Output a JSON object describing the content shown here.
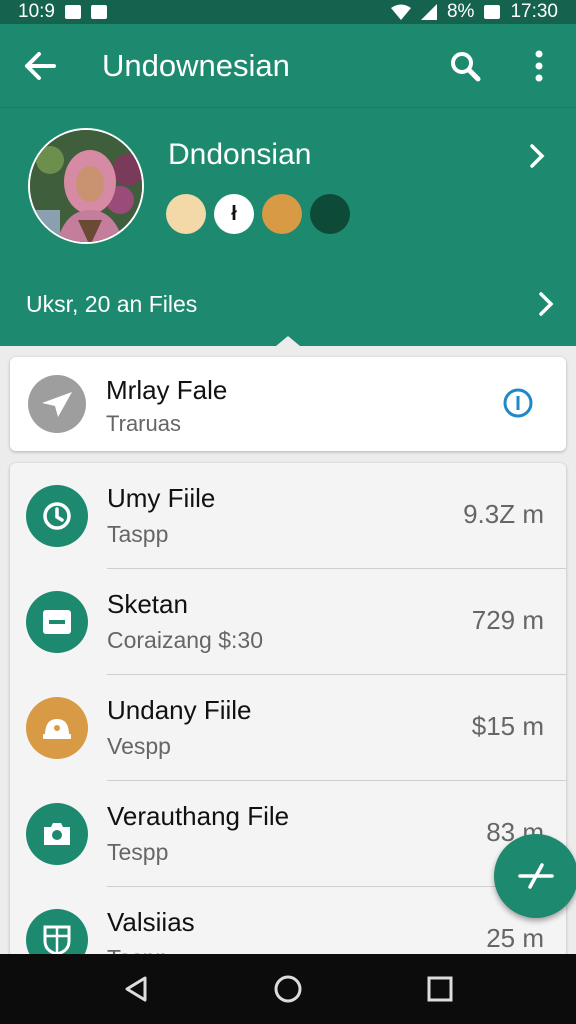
{
  "status_bar": {
    "time_left": "10:9",
    "battery": "8%",
    "time_right": "17:30"
  },
  "app_bar": {
    "title": "Undownesian",
    "back_icon": "arrow-back-icon",
    "search_icon": "search-icon",
    "menu_icon": "more-vert-icon"
  },
  "profile": {
    "name": "Dndonsian",
    "color_dots": [
      {
        "color": "#f3d9a8",
        "label": ""
      },
      {
        "color": "#ffffff",
        "label": "ł"
      },
      {
        "color": "#d99a45",
        "label": ""
      },
      {
        "color": "#0d4a37",
        "label": ""
      }
    ],
    "files_label": "Uksr, 20 an Files"
  },
  "top_card": {
    "title": "Mrlay Fale",
    "subtitle": "Traruas",
    "icon": "send-icon",
    "info_icon": "info-icon"
  },
  "files": [
    {
      "name": "Umy Fiile",
      "sub": "Taspp",
      "size": "9.3Z m",
      "icon": "clock-icon",
      "color": "#1d8a6f"
    },
    {
      "name": "Sketan",
      "sub": "Coraizang $:30",
      "size": "729 m",
      "icon": "minus-box-icon",
      "color": "#1d8a6f"
    },
    {
      "name": "Undany Fiile",
      "sub": "Vespp",
      "size": "$15 m",
      "icon": "dome-icon",
      "color": "#d99a45"
    },
    {
      "name": "Verauthang File",
      "sub": "Tespp",
      "size": "83 m",
      "icon": "camera-icon",
      "color": "#1d8a6f"
    },
    {
      "name": "Valsiias",
      "sub": "Taspp",
      "size": "25 m",
      "icon": "shield-icon",
      "color": "#1d8a6f"
    }
  ],
  "fab": {
    "icon": "edit-icon"
  },
  "nav_bar": {
    "back_icon": "nav-back-icon",
    "home_icon": "nav-home-icon",
    "recents_icon": "nav-recents-icon"
  },
  "colors": {
    "primary": "#1d8a6f",
    "primary_dark": "#15624f",
    "accent_orange": "#d99a45"
  }
}
